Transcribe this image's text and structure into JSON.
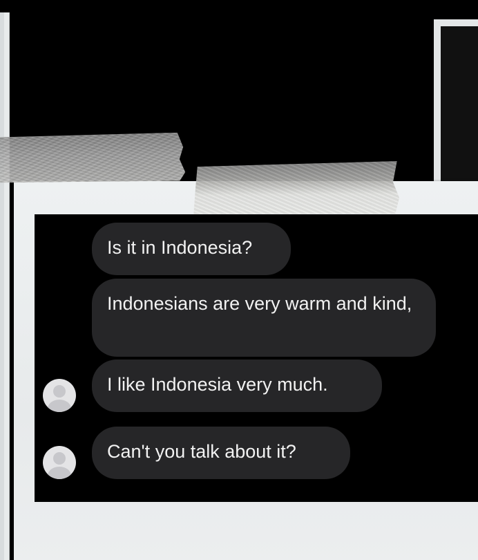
{
  "chat": {
    "messages": [
      {
        "text": "Is it in Indonesia?",
        "show_avatar": false
      },
      {
        "text": "Indonesians are very warm and kind,",
        "show_avatar": false
      },
      {
        "text": "I like Indonesia very much.",
        "show_avatar": true
      },
      {
        "text": "Can't you talk about it?",
        "show_avatar": true
      }
    ]
  },
  "colors": {
    "background": "#000000",
    "bubble": "#262628",
    "bubble_text": "#f2f2f2",
    "polaroid_frame": "#eef1f2",
    "avatar": "#e4e4e6"
  },
  "icons": {
    "avatar": "default-user-avatar-icon"
  }
}
